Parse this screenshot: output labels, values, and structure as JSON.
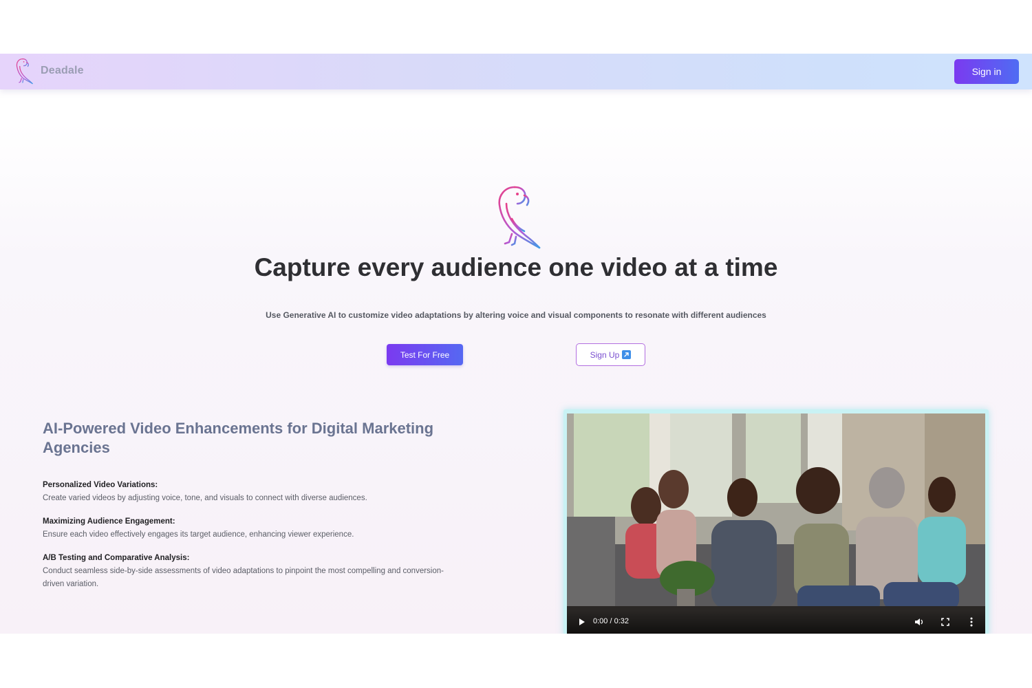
{
  "brand": {
    "name": "Deadale"
  },
  "nav": {
    "signin_label": "Sign in"
  },
  "hero": {
    "title": "Capture every audience one video at a time",
    "subtitle": "Use Generative AI to customize video adaptations by altering voice and visual components to resonate with different audiences",
    "primary_button": "Test For Free",
    "secondary_button": "Sign Up"
  },
  "features": {
    "title": "AI-Powered Video Enhancements for Digital Marketing Agencies",
    "items": [
      {
        "title": "Personalized Video Variations:",
        "description": "Create varied videos by adjusting voice, tone, and visuals to connect with diverse audiences."
      },
      {
        "title": "Maximizing Audience Engagement:",
        "description": "Ensure each video effectively engages its target audience, enhancing viewer experience."
      },
      {
        "title": "A/B Testing and Comparative Analysis:",
        "description": "Conduct seamless side-by-side assessments of video adaptations to pinpoint the most compelling and conversion-driven variation."
      }
    ]
  },
  "video": {
    "time": "0:00 / 0:32",
    "icons": [
      "play-icon",
      "volume-icon",
      "fullscreen-icon",
      "more-options-icon"
    ]
  },
  "colors": {
    "accent_purple": "#7b3af0",
    "accent_blue": "#4f6cf3",
    "title_dark": "#2f2f33",
    "features_title": "#6a7491"
  }
}
